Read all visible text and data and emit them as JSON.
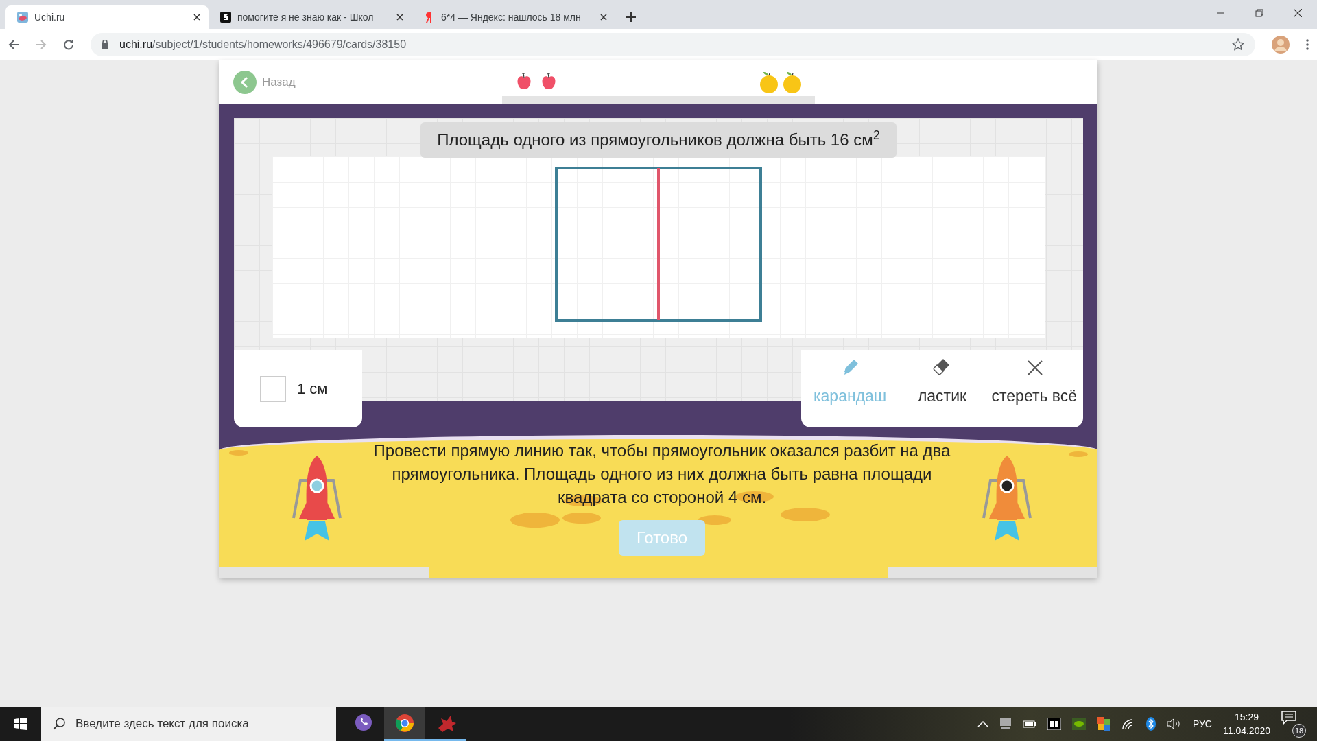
{
  "browser": {
    "tabs": [
      {
        "title": "Uchi.ru",
        "kind": "uchi",
        "selected": true
      },
      {
        "title": "помогите я не знаю как - Школ",
        "kind": "znanija",
        "selected": false
      },
      {
        "title": "6*4 — Яндекс: нашлось 18 млн",
        "kind": "yandex",
        "selected": false
      }
    ],
    "address": {
      "host": "uchi.ru",
      "path": "/subject/1/students/homeworks/496679/cards/38150"
    }
  },
  "header": {
    "back": "Назад"
  },
  "task": {
    "title": "Площадь одного из прямоугольников должна быть 16 см$^{2}$",
    "scale_label": "1 см",
    "tools": [
      {
        "label": "карандаш",
        "kind": "pencil",
        "selected": true
      },
      {
        "label": "ластик",
        "kind": "eraser",
        "selected": false
      },
      {
        "label": "стереть всё",
        "kind": "clear",
        "selected": false
      }
    ],
    "instruction": "Провести прямую линию так, чтобы прямоугольник оказался разбит на два прямоугольника. Площадь одного из них должна быть равна площади квадрата со стороной 4 см.",
    "done_button": {
      "label": "Готово",
      "disabled": true
    }
  },
  "taskbar": {
    "search_placeholder": "Введите здесь текст для поиска",
    "apps": [
      {
        "kind": "messenger",
        "running": false,
        "selected": false
      },
      {
        "kind": "browser",
        "running": true,
        "selected": true
      },
      {
        "kind": "game",
        "running": true,
        "selected": false
      }
    ],
    "language": "РУС",
    "time": "15:29",
    "date": "11.04.2020",
    "notifications": "18"
  }
}
